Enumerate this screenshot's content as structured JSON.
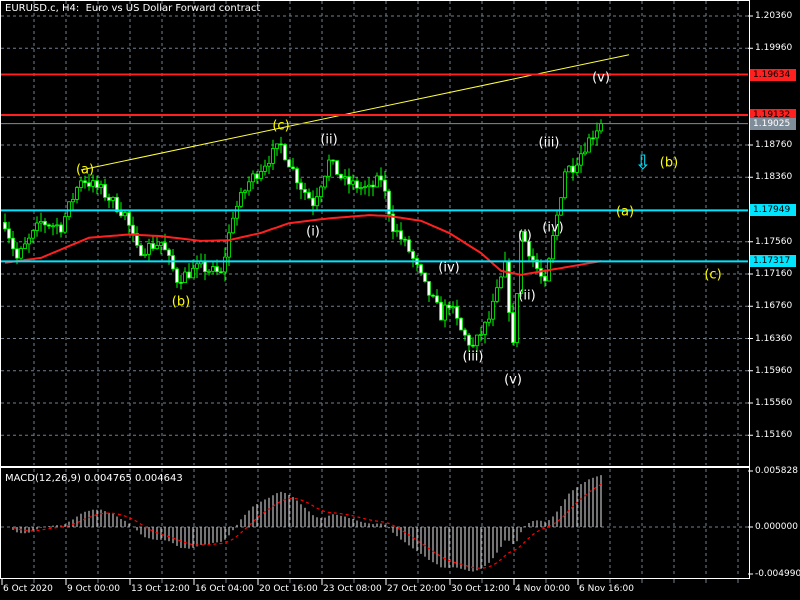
{
  "header": {
    "title": "EURUSD.c, H4:  Euro vs US Dollar Forward contract"
  },
  "colors": {
    "background": "#000000",
    "grid": "#6f7f8f",
    "bull": "#00ff00",
    "ma": "#ff2020",
    "trend": "#ffff40",
    "resistance": "#ff2020",
    "support": "#00e5ff",
    "bid": "#7f8c99",
    "wave_major": "#ffff00",
    "wave_minor": "#ffffff",
    "macd_hist": "#c0c0c0",
    "macd_signal": "#ff0000"
  },
  "chart_data": {
    "type": "candlestick",
    "symbol": "EURUSD.c",
    "timeframe": "H4",
    "ylim": [
      1.1474,
      1.2056
    ],
    "y_ticks": [
      "1.20360",
      "1.19960",
      "1.18760",
      "1.18360",
      "1.17560",
      "1.17160",
      "1.16760",
      "1.16360",
      "1.15960",
      "1.15560",
      "1.15160"
    ],
    "x_ticks": [
      "6 Oct 2020",
      "9 Oct 00:00",
      "13 Oct 12:00",
      "16 Oct 04:00",
      "20 Oct 16:00",
      "23 Oct 08:00",
      "27 Oct 20:00",
      "30 Oct 12:00",
      "4 Nov 00:00",
      "6 Nov 16:00"
    ],
    "close_path": {
      "bar": [
        0,
        3,
        9,
        14,
        19,
        24,
        30,
        33,
        39,
        43,
        49,
        54,
        57,
        61,
        66,
        69,
        74,
        77,
        81,
        85,
        91,
        94,
        97,
        101,
        105,
        109,
        111,
        114,
        117,
        121,
        125,
        127,
        129,
        135,
        137,
        140,
        142,
        145,
        149
      ],
      "price": [
        1.178,
        1.1735,
        1.178,
        1.1775,
        1.1835,
        1.182,
        1.179,
        1.1745,
        1.1755,
        1.171,
        1.1725,
        1.1715,
        1.179,
        1.183,
        1.186,
        1.1875,
        1.1825,
        1.1805,
        1.1855,
        1.183,
        1.182,
        1.1835,
        1.1775,
        1.1745,
        1.17,
        1.1665,
        1.168,
        1.1645,
        1.1625,
        1.166,
        1.1725,
        1.1625,
        1.1768,
        1.17,
        1.176,
        1.1845,
        1.185,
        1.1875,
        1.1905
      ]
    },
    "moving_average": {
      "bar": [
        0,
        9,
        21,
        31,
        39,
        49,
        56,
        64,
        71,
        81,
        91,
        96,
        104,
        111,
        119,
        124,
        129,
        135,
        141,
        149
      ],
      "price": [
        1.173,
        1.1736,
        1.1761,
        1.1765,
        1.1763,
        1.1757,
        1.1758,
        1.1767,
        1.1779,
        1.1785,
        1.1789,
        1.1788,
        1.1782,
        1.1767,
        1.1742,
        1.172,
        1.1715,
        1.172,
        1.1725,
        1.1732
      ]
    },
    "levels": [
      {
        "name": "resistance-high",
        "price": "1.19634",
        "kind": "resistance"
      },
      {
        "name": "resistance-low",
        "price": "1.19132",
        "kind": "resistance"
      },
      {
        "name": "bid",
        "price": "1.19025",
        "kind": "bid"
      },
      {
        "name": "support-high",
        "price": "1.17949",
        "kind": "support"
      },
      {
        "name": "support-low",
        "price": "1.17317",
        "kind": "support"
      }
    ],
    "trendline": {
      "from": {
        "bar": 19,
        "price": 1.1845
      },
      "to": {
        "bar": 156,
        "price": 1.1988
      }
    },
    "wave_labels": [
      {
        "text": "(a)",
        "bar": 20,
        "price": 1.1845,
        "kind": "major"
      },
      {
        "text": "(b)",
        "bar": 44,
        "price": 1.1681,
        "kind": "major"
      },
      {
        "text": "(c)",
        "bar": 69,
        "price": 1.19,
        "kind": "major"
      },
      {
        "text": "(i)",
        "bar": 77,
        "price": 1.1768,
        "kind": "minor"
      },
      {
        "text": "(ii)",
        "bar": 81,
        "price": 1.1882,
        "kind": "minor"
      },
      {
        "text": "(iv)",
        "bar": 111,
        "price": 1.1723,
        "kind": "minor"
      },
      {
        "text": "(iii)",
        "bar": 117,
        "price": 1.1613,
        "kind": "minor"
      },
      {
        "text": "(v)",
        "bar": 127,
        "price": 1.1585,
        "kind": "minor"
      },
      {
        "text": "(i)",
        "bar": 130,
        "price": 1.1763,
        "kind": "minor"
      },
      {
        "text": "(ii)",
        "bar": 130.5,
        "price": 1.1689,
        "kind": "minor"
      },
      {
        "text": "(iv)",
        "bar": 137,
        "price": 1.1773,
        "kind": "minor"
      },
      {
        "text": "(iii)",
        "bar": 136,
        "price": 1.1879,
        "kind": "minor"
      },
      {
        "text": "(v)",
        "bar": 149,
        "price": 1.1959,
        "kind": "minor"
      },
      {
        "text": "(b)",
        "bar": 166,
        "price": 1.1854,
        "kind": "major"
      },
      {
        "text": "(a)",
        "bar": 155,
        "price": 1.1793,
        "kind": "major"
      },
      {
        "text": "(c)",
        "bar": 177,
        "price": 1.1715,
        "kind": "major"
      }
    ],
    "arrow": {
      "icon": "down-arrow",
      "bar": 159.5,
      "price": 1.1855
    },
    "macd": {
      "label": "MACD(12,26,9) 0.004765 0.004643",
      "params": [
        12,
        26,
        9
      ],
      "main": 0.004765,
      "signal": 0.004643,
      "ylim": [
        -0.00499,
        0.005828
      ],
      "y_ticks": [
        "0.005828",
        "0.000000",
        "-0.004990"
      ]
    }
  }
}
